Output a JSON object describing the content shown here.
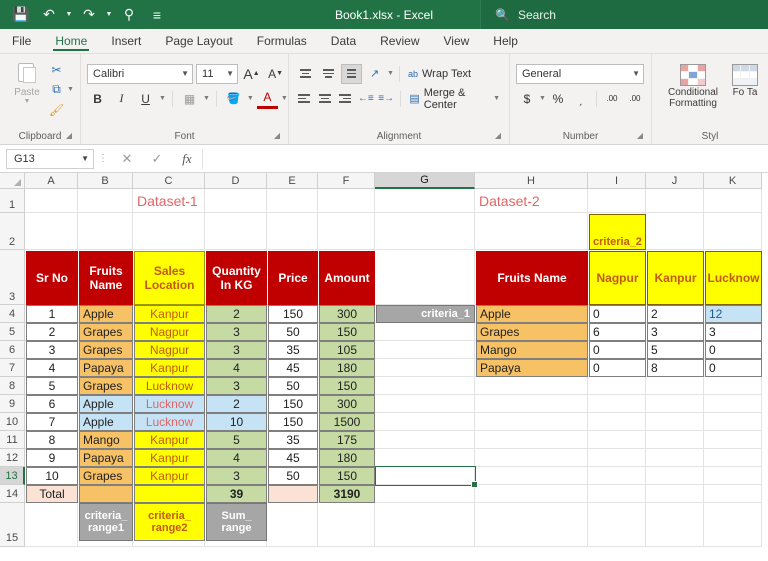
{
  "titlebar": {
    "document_title": "Book1.xlsx  -  Excel",
    "qat": [
      {
        "name": "save-icon",
        "glyph": "💾"
      },
      {
        "name": "undo-icon",
        "glyph": "↶"
      },
      {
        "name": "redo-icon",
        "glyph": "↷"
      },
      {
        "name": "search-icon",
        "glyph": "⚲"
      },
      {
        "name": "customize-quick-access-toolbar-icon",
        "glyph": "≡"
      }
    ],
    "search_placeholder": "Search",
    "search_icon": "🔍"
  },
  "tabs": [
    {
      "label": "File",
      "active": false
    },
    {
      "label": "Home",
      "active": true
    },
    {
      "label": "Insert",
      "active": false
    },
    {
      "label": "Page Layout",
      "active": false
    },
    {
      "label": "Formulas",
      "active": false
    },
    {
      "label": "Data",
      "active": false
    },
    {
      "label": "Review",
      "active": false
    },
    {
      "label": "View",
      "active": false
    },
    {
      "label": "Help",
      "active": false
    }
  ],
  "ribbon": {
    "clipboard": {
      "label": "Clipboard",
      "paste_label": "Paste",
      "cut_icon": "✂",
      "copy_icon": "⧉",
      "format_painter_icon": "🖌"
    },
    "font": {
      "label": "Font",
      "font_name": "Calibri",
      "font_size": "11",
      "grow_font": "A",
      "shrink_font": "A",
      "bold": "B",
      "italic": "I",
      "underline": "U",
      "borders_icon": "▦",
      "fill_color_icon": "🪣",
      "font_color_icon": "A"
    },
    "alignment": {
      "label": "Alignment",
      "wrap_text": "Wrap Text",
      "wrap_text_icon": "ab",
      "merge_center": "Merge & Center",
      "merge_center_icon": "▤",
      "orientation_icon": "↗",
      "decrease_indent_icon": "←≡",
      "increase_indent_icon": "≡→"
    },
    "number": {
      "label": "Number",
      "format": "General",
      "currency": "$",
      "percent": "%",
      "comma": "͵",
      "increase_decimal": ".00",
      "decrease_decimal": ".00"
    },
    "styles": {
      "label": "Styles",
      "label_short": "Styl",
      "conditional_formatting": "Conditional\nFormatting",
      "format_as_table": "Fo\nTa"
    }
  },
  "formula_bar": {
    "name_box": "G13",
    "cancel_icon": "✕",
    "enter_icon": "✓",
    "function_icon": "fx",
    "formula": ""
  },
  "sheet": {
    "columns": [
      "A",
      "B",
      "C",
      "D",
      "E",
      "F",
      "G",
      "H",
      "I",
      "J",
      "K"
    ],
    "selected_column": "G",
    "rows": [
      "1",
      "2",
      "3",
      "4",
      "5",
      "6",
      "7",
      "8",
      "9",
      "10",
      "11",
      "12",
      "13",
      "14",
      "15"
    ],
    "selected_row": "13",
    "selected_cell": "G13",
    "titles": {
      "dataset1": "Dataset-1",
      "dataset2": "Dataset-2"
    },
    "dataset1": {
      "headers": [
        "Sr No",
        "Fruits\nName",
        "Sales\nLocation",
        "Quantity\nIn KG",
        "Price",
        "Amount"
      ],
      "rows": [
        {
          "sr": "1",
          "fruit": "Apple",
          "location": "Kanpur",
          "qty": "2",
          "price": "150",
          "amount": "300"
        },
        {
          "sr": "2",
          "fruit": "Grapes",
          "location": "Nagpur",
          "qty": "3",
          "price": "50",
          "amount": "150"
        },
        {
          "sr": "3",
          "fruit": "Grapes",
          "location": "Nagpur",
          "qty": "3",
          "price": "35",
          "amount": "105"
        },
        {
          "sr": "4",
          "fruit": "Papaya",
          "location": "Kanpur",
          "qty": "4",
          "price": "45",
          "amount": "180"
        },
        {
          "sr": "5",
          "fruit": "Grapes",
          "location": "Lucknow",
          "qty": "3",
          "price": "50",
          "amount": "150"
        },
        {
          "sr": "6",
          "fruit": "Apple",
          "location": "Lucknow",
          "qty": "2",
          "price": "150",
          "amount": "300"
        },
        {
          "sr": "7",
          "fruit": "Apple",
          "location": "Lucknow",
          "qty": "10",
          "price": "150",
          "amount": "1500"
        },
        {
          "sr": "8",
          "fruit": "Mango",
          "location": "Kanpur",
          "qty": "5",
          "price": "35",
          "amount": "175"
        },
        {
          "sr": "9",
          "fruit": "Papaya",
          "location": "Kanpur",
          "qty": "4",
          "price": "45",
          "amount": "180"
        },
        {
          "sr": "10",
          "fruit": "Grapes",
          "location": "Kanpur",
          "qty": "3",
          "price": "50",
          "amount": "150"
        }
      ],
      "total": {
        "label": "Total",
        "qty": "39",
        "amount": "3190"
      }
    },
    "dataset2": {
      "header_fruit": "Fruits Name",
      "header_locations": [
        "Nagpur",
        "Kanpur",
        "Lucknow"
      ],
      "rows": [
        {
          "fruit": "Apple",
          "nagpur": "0",
          "kanpur": "2",
          "lucknow": "12"
        },
        {
          "fruit": "Grapes",
          "nagpur": "6",
          "kanpur": "3",
          "lucknow": "3"
        },
        {
          "fruit": "Mango",
          "nagpur": "0",
          "kanpur": "5",
          "lucknow": "0"
        },
        {
          "fruit": "Papaya",
          "nagpur": "0",
          "kanpur": "8",
          "lucknow": "0"
        }
      ]
    },
    "annotations": {
      "criteria_1": "criteria_1",
      "criteria_2": "criteria_2",
      "criteria_range1": "criteria_\nrange1",
      "criteria_range2": "criteria_\nrange2",
      "sum_range": "Sum_\nrange"
    }
  },
  "colors": {
    "brand_green": "#217346",
    "header_red": "#c00000",
    "highlight_yellow": "#ffff00",
    "orange_fill": "#f7c265",
    "green_fill": "#c6dba4",
    "blue_fill": "#c5e3f5",
    "peach_fill": "#fbe2d5",
    "gray_tag": "#a6a6a6"
  }
}
